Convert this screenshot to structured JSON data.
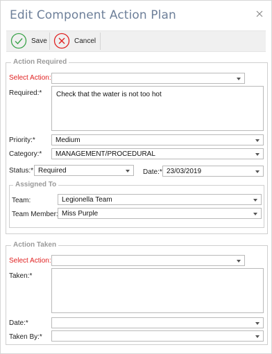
{
  "dialog": {
    "title": "Edit Component Action Plan",
    "accent_color": "#6d7f99"
  },
  "toolbar": {
    "save_label": "Save",
    "cancel_label": "Cancel",
    "save_icon": "check-circle-icon",
    "cancel_icon": "x-circle-icon",
    "save_color": "#3aa34a",
    "cancel_color": "#e02020"
  },
  "action_required": {
    "legend": "Action Required",
    "select_action_label": "Select Action:",
    "select_action_value": "",
    "required_label": "Required:*",
    "required_value": "Check that the water is not too hot",
    "priority_label": "Priority:*",
    "priority_value": "Medium",
    "category_label": "Category:*",
    "category_value": "MANAGEMENT/PROCEDURAL",
    "status_label": "Status:*",
    "status_value": "Required",
    "date_label": "Date:*",
    "date_value": "23/03/2019",
    "assigned_to": {
      "legend": "Assigned To",
      "team_label": "Team:",
      "team_value": "Legionella Team",
      "member_label": "Team Member:",
      "member_value": "Miss Purple"
    }
  },
  "action_taken": {
    "legend": "Action Taken",
    "select_action_label": "Select Action:",
    "select_action_value": "",
    "taken_label": "Taken:*",
    "taken_value": "",
    "date_label": "Date:*",
    "date_value": "",
    "taken_by_label": "Taken By:*",
    "taken_by_value": ""
  }
}
